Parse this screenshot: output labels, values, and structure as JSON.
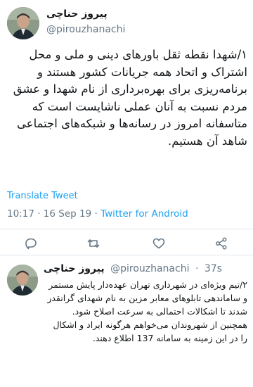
{
  "main_tweet": {
    "author_name": "پیروز حناچی",
    "handle": "@pirouzhanachi",
    "text": "۱/شهدا نقطه ثقل باورهای دینی و ملی و محل اشتراک و اتحاد همه جریانات کشور هستند و برنامه‌ریزی برای بهره‌برداری از نام شهدا و عشق مردم نسبت به آنان عملی ناشایست است که متاسفانه امروز در رسانه‌ها و شبکه‌های اجتماعی شاهد آن هستیم.",
    "translate_label": "Translate Tweet",
    "time": "10:17",
    "separator": "·",
    "date": "16 Sep 19",
    "source": "Twitter for Android"
  },
  "reply_tweet": {
    "author_name": "پیروز حناچی",
    "handle": "@pirouzhanachi",
    "separator": "·",
    "age": "37s",
    "paragraph_1": "۲/تیم ویژه‌ای در شهرداری تهران عهده‌دار پایش مستمر و ساماندهی تابلوهای معابر مزین به نام شهدای گرانقدر شدند تا اشکالات احتمالی به سرعت اصلاح شود.",
    "paragraph_2": "همچنین از شهروندان می‌خواهم هرگونه ایراد و اشکال را در این زمینه به سامانه 137 اطلاع دهند."
  },
  "icons": {
    "reply": "comment-icon",
    "retweet": "retweet-icon",
    "like": "heart-icon",
    "share": "share-icon"
  },
  "colors": {
    "link": "#1da1f2",
    "secondary_text": "#657786",
    "divider": "#e1e8ed"
  }
}
